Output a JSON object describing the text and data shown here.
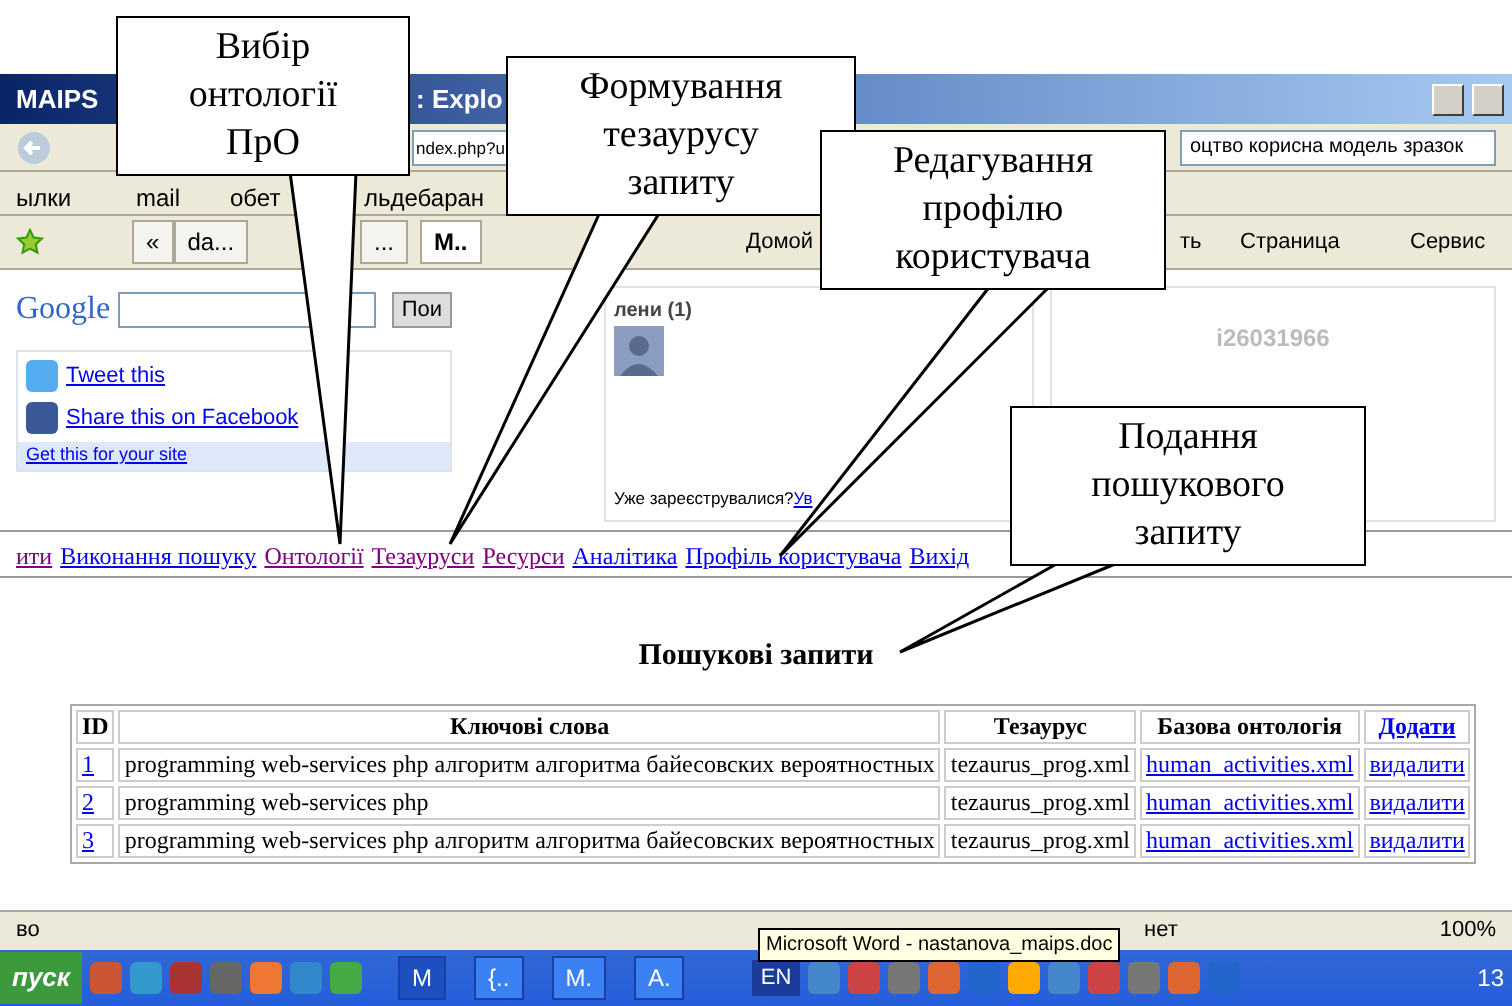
{
  "window": {
    "title_start": "MAIPS",
    "title_end": ": Explo"
  },
  "address_bar": {
    "url": "ndex.php?u",
    "search_value": "оцтво корисна модель зразок"
  },
  "links_bar": {
    "label": "ылки",
    "links": [
      "mail",
      "обет",
      "льдебаран"
    ]
  },
  "tab_list_button": "«",
  "tabs": [
    {
      "label": "da...",
      "selected": false
    },
    {
      "label": "...",
      "selected": false
    },
    {
      "label": "M..",
      "selected": true
    }
  ],
  "command_bar": [
    "Домой",
    "ть",
    "Страница",
    "Сервис"
  ],
  "page": {
    "google_logo": "Google",
    "google_button": "Пои",
    "share_links": [
      "Tweet this",
      "Share this on Facebook"
    ],
    "get_link": "Get this for your site",
    "members_title": "лени (1)",
    "registered_text": "Уже зареєструвалися?",
    "login_link": "Ув",
    "widget_id": "i26031966"
  },
  "nav": [
    {
      "label": "ити",
      "visited": true
    },
    {
      "label": "Виконання пошуку",
      "visited": false
    },
    {
      "label": "Онтології",
      "visited": true
    },
    {
      "label": "Тезауруси",
      "visited": true
    },
    {
      "label": "Ресурси",
      "visited": true
    },
    {
      "label": "Аналітика",
      "visited": false
    },
    {
      "label": "Профіль користувача",
      "visited": false
    },
    {
      "label": "Вихід",
      "visited": false
    }
  ],
  "heading": "Пошукові запити",
  "table": {
    "columns": [
      "ID",
      "Ключові слова",
      "Тезаурус",
      "Базова онтологія"
    ],
    "add_link": "Додати",
    "rows": [
      {
        "id": "1",
        "keywords": "programming web-services php алгоритм алгоритма байесовских вероятностных",
        "thesaurus": "tezaurus_prog.xml",
        "ontology": "human_activities.xml",
        "action": "видалити"
      },
      {
        "id": "2",
        "keywords": "programming web-services php",
        "thesaurus": "tezaurus_prog.xml",
        "ontology": "human_activities.xml",
        "action": "видалити"
      },
      {
        "id": "3",
        "keywords": "programming web-services php алгоритм алгоритма байесовских вероятностных",
        "thesaurus": "tezaurus_prog.xml",
        "ontology": "human_activities.xml",
        "action": "видалити"
      }
    ]
  },
  "status_bar": {
    "left": "во",
    "zone": "нет",
    "zoom": "100%"
  },
  "taskbar": {
    "start": "пуск",
    "buttons": [
      "M",
      "{..",
      "M.",
      "A."
    ],
    "language": "EN",
    "clock": "13",
    "tooltip": "Microsoft Word - nastanova_maips.doc"
  },
  "callouts": [
    {
      "text": "Вибір\nонтології\nПрО"
    },
    {
      "text": "Формування\nтезаурусу\nзапиту"
    },
    {
      "text": "Редагування\nпрофілю\nкористувача"
    },
    {
      "text": "Подання\nпошукового\nзапиту"
    }
  ]
}
